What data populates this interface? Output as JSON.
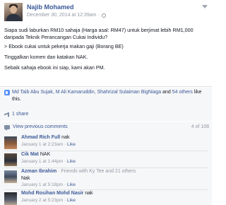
{
  "post": {
    "author": "Najib Mohamed",
    "date": "December 30, 2014 at 12:39am ·",
    "paragraphs": [
      "Siapa sudi laburkan RM10 sahaja (Harga asal: RM47) untuk berjimat lebih RM1,000 daripada Teknik Perancangan Cukai Individu?",
      "> Ebook cukai untuk pekerja makan gaji (Borang BE)",
      "Tinggalkan komen dan katakan NAK.",
      "Sebaik sahaja ebook ini siap, kami akan PM."
    ]
  },
  "likes": {
    "names": "Md Taib Abu Sujak, M Ali Kamaruddin, Shahrizal Sulaiman BigNiaga",
    "and": " and ",
    "others": "54 others",
    "suffix": " like this."
  },
  "share": {
    "label": "1 share"
  },
  "comments_bar": {
    "view_previous": "View previous comments",
    "count": "4 of 108"
  },
  "comments": [
    {
      "name": "Ahmad Rich Full",
      "text": " nak",
      "time": "January 1 at 2:23am · ",
      "like": "Like"
    },
    {
      "name": "Cik Mat",
      "text": " NAK",
      "time": "January 1 at 1:44pm · ",
      "like": "Like"
    },
    {
      "name": "Azman Ibrahim",
      "text": " · Friends with Ky Tee and 21 others",
      "line2": "Nak",
      "time": "January 1 at 5:18pm · ",
      "like": "Like"
    },
    {
      "name": "Mohd Rosihan Mohd Nasir",
      "text": " nak",
      "time": "January 2 at 5:23pm · ",
      "like": "Like"
    }
  ],
  "colors": {
    "link": "#3b5998",
    "meta": "#9197a3",
    "panel": "#f6f7f8"
  },
  "icons": [
    "globe-icon",
    "chevron-down-icon",
    "like-icon",
    "share-icon",
    "comment-icon"
  ]
}
